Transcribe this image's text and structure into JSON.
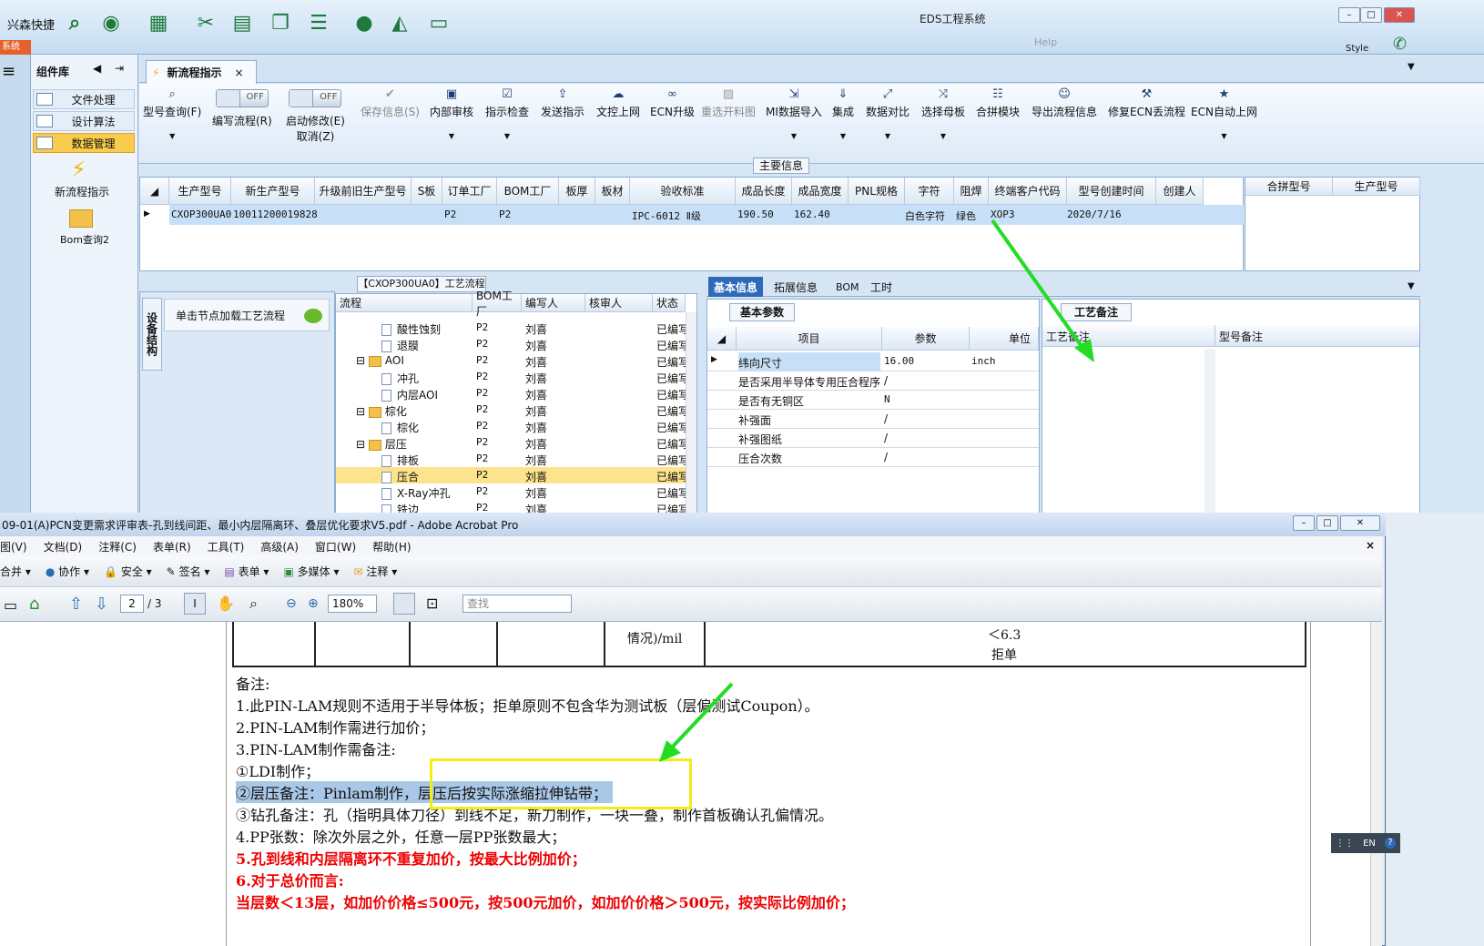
{
  "app": {
    "quick_label": "兴森快捷",
    "title": "EDS工程系统",
    "help": "Help",
    "style": "Style",
    "red_tab": "系统"
  },
  "sidebar": {
    "header": "组件库",
    "items": [
      {
        "label": "文件处理"
      },
      {
        "label": "设计算法"
      },
      {
        "label": "数据管理"
      }
    ],
    "tools": [
      {
        "label": "新流程指示"
      },
      {
        "label": "Bom查询2"
      }
    ]
  },
  "tab": {
    "label": "新流程指示"
  },
  "ribbon": {
    "toggle_off": "OFF",
    "buttons": [
      {
        "label": "型号查询(F)"
      },
      {
        "label": "编写流程(R)"
      },
      {
        "label": "启动修改(E)",
        "sub": "取消(Z)"
      },
      {
        "label": "保存信息(S)"
      },
      {
        "label": "内部审核"
      },
      {
        "label": "指示检查"
      },
      {
        "label": "发送指示"
      },
      {
        "label": "文控上网"
      },
      {
        "label": "ECN升级"
      },
      {
        "label": "重选开料图"
      },
      {
        "label": "MI数据导入"
      },
      {
        "label": "集成"
      },
      {
        "label": "数据对比"
      },
      {
        "label": "选择母板"
      },
      {
        "label": "合拼模块"
      },
      {
        "label": "导出流程信息"
      },
      {
        "label": "修复ECN丢流程"
      },
      {
        "label": "ECN自动上网"
      }
    ]
  },
  "main": {
    "header": "主要信息",
    "columns": [
      "生产型号",
      "新生产型号",
      "升级前旧生产型号",
      "S板",
      "订单工厂",
      "BOM工厂",
      "板厚",
      "板材",
      "验收标准",
      "成品长度",
      "成品宽度",
      "PNL规格",
      "字符",
      "阻焊",
      "终端客户代码",
      "型号创建时间",
      "创建人"
    ],
    "row": [
      "CXOP300UA0",
      "10011200019828",
      "",
      "",
      "P2",
      "P2",
      "",
      "",
      "IPC-6012 Ⅱ级",
      "190.50",
      "162.40",
      "",
      "白色字符",
      "绿色",
      "XOP3",
      "2020/7/16",
      ""
    ],
    "right_columns": [
      "合拼型号",
      "生产型号"
    ]
  },
  "process": {
    "title": "【CXOP300UA0】工艺流程",
    "vertical_tab": "设备结构",
    "click_hint": "单击节点加载工艺流程",
    "columns": [
      "流程",
      "BOM工厂",
      "编写人",
      "核审人",
      "状态"
    ],
    "rows": [
      {
        "name": "酸性蚀刻",
        "bom": "P2",
        "writer": "刘喜",
        "status": "已编写",
        "type": "doc"
      },
      {
        "name": "退膜",
        "bom": "P2",
        "writer": "刘喜",
        "status": "已编写",
        "type": "doc"
      },
      {
        "name": "AOI",
        "bom": "P2",
        "writer": "刘喜",
        "status": "已编写",
        "type": "folder"
      },
      {
        "name": "冲孔",
        "bom": "P2",
        "writer": "刘喜",
        "status": "已编写",
        "type": "doc"
      },
      {
        "name": "内层AOI",
        "bom": "P2",
        "writer": "刘喜",
        "status": "已编写",
        "type": "doc"
      },
      {
        "name": "棕化",
        "bom": "P2",
        "writer": "刘喜",
        "status": "已编写",
        "type": "folder"
      },
      {
        "name": "棕化",
        "bom": "P2",
        "writer": "刘喜",
        "status": "已编写",
        "type": "doc"
      },
      {
        "name": "层压",
        "bom": "P2",
        "writer": "刘喜",
        "status": "已编写",
        "type": "folder"
      },
      {
        "name": "排板",
        "bom": "P2",
        "writer": "刘喜",
        "status": "已编写",
        "type": "doc"
      },
      {
        "name": "压合",
        "bom": "P2",
        "writer": "刘喜",
        "status": "已编写",
        "type": "doc"
      },
      {
        "name": "X-Ray冲孔",
        "bom": "P2",
        "writer": "刘喜",
        "status": "已编写",
        "type": "doc"
      },
      {
        "name": "铣边",
        "bom": "P2",
        "writer": "刘喜",
        "status": "已编写",
        "type": "doc"
      }
    ]
  },
  "info": {
    "tabs": [
      "基本信息",
      "拓展信息",
      "BOM",
      "工时"
    ],
    "subtab": "基本参数",
    "columns": [
      "项目",
      "参数",
      "单位"
    ],
    "rows": [
      {
        "item": "纬向尺寸",
        "param": "16.00",
        "unit": "inch"
      },
      {
        "item": "是否采用半导体专用压合程序",
        "param": "/",
        "unit": ""
      },
      {
        "item": "是否有无铜区",
        "param": "N",
        "unit": ""
      },
      {
        "item": "补强面",
        "param": "/",
        "unit": ""
      },
      {
        "item": "补强图纸",
        "param": "/",
        "unit": ""
      },
      {
        "item": "压合次数",
        "param": "/",
        "unit": ""
      }
    ],
    "remark_tab": "工艺备注",
    "remark_columns": [
      "工艺备注",
      "型号备注"
    ]
  },
  "acrobat": {
    "title": "09-01(A)PCN变更需求评审表-孔到线间距、最小内层隔离环、叠层优化要求V5.pdf - Adobe Acrobat Pro",
    "menu": [
      "图(V)",
      "文档(D)",
      "注释(C)",
      "表单(R)",
      "工具(T)",
      "高级(A)",
      "窗口(W)",
      "帮助(H)"
    ],
    "toolbar": [
      "合并",
      "协作",
      "安全",
      "签名",
      "表单",
      "多媒体",
      "注释"
    ],
    "page_current": "2",
    "page_total": "/ 3",
    "zoom": "180%",
    "search_placeholder": "查找",
    "table_cell": "情况)/mil",
    "table_value": "＜6.3",
    "table_reject": "拒单",
    "lines": [
      "备注:",
      "1.此PIN-LAM规则不适用于半导体板；拒单原则不包含华为测试板（层偏测试Coupon）。",
      "2.PIN-LAM制作需进行加价；",
      "3.PIN-LAM制作需备注:",
      "①LDI制作；",
      "②层压备注：Pinlam制作，层压后按实际涨缩拉伸钻带；",
      "③钻孔备注：孔（指明具体刀径）到线不足，新刀制作，一块一叠，制作首板确认孔偏情况。",
      "4.PP张数：除次外层之外，任意一层PP张数最大；",
      "5.孔到线和内层隔离环不重复加价，按最大比例加价；",
      "6.对于总价而言:",
      "当层数＜13层，如加价价格≤500元，按500元加价，如加价价格＞500元，按实际比例加价；"
    ]
  },
  "lang": {
    "label": "EN"
  },
  "colors": {
    "accent": "#1d7a3a",
    "arrow": "#22dd22",
    "highlight": "#f2ec18",
    "red_text": "#e00000"
  }
}
